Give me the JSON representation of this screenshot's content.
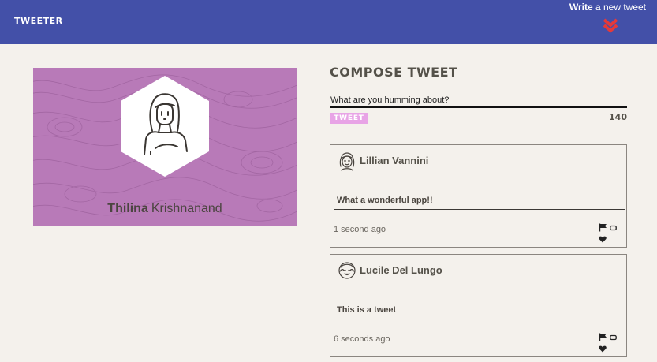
{
  "nav": {
    "brand": "TWEETER",
    "write_bold": "Write",
    "write_rest": " a new tweet",
    "toggle_icon": "double-chevron-down-icon",
    "background": "#4350a8",
    "toggle_color": "#e53939"
  },
  "profile": {
    "first_name": "Thilina",
    "last_name": "Krishnanand",
    "avatar_icon": "user-avatar-icon",
    "card_color": "#b87ab8"
  },
  "compose": {
    "title": "COMPOSE TWEET",
    "placeholder": "What are you humming about?",
    "button_label": "TWEET",
    "counter": "140",
    "button_color": "#e8a4e6"
  },
  "tweets": [
    {
      "author": "Lillian Vannini",
      "text": "What a wonderful app!!",
      "time": "1 second ago",
      "avatar_icon": "user-avatar-icon"
    },
    {
      "author": "Lucile Del Lungo",
      "text": "This is a tweet",
      "time": "6 seconds ago",
      "avatar_icon": "user-avatar-icon"
    }
  ]
}
